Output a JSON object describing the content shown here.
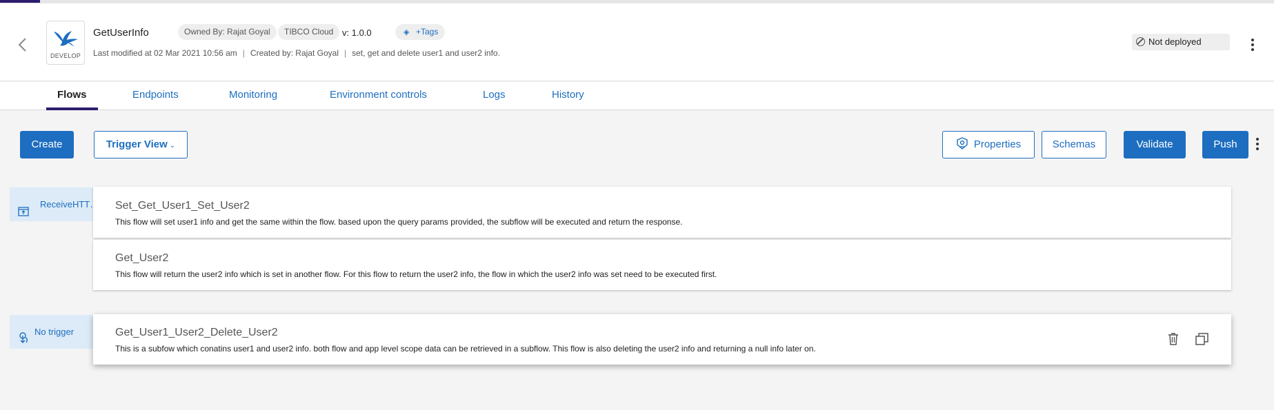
{
  "app": {
    "name": "GetUserInfo",
    "stage_badge": "DEVELOP",
    "owned_by": "Owned By: Rajat Goyal",
    "cloud": "TIBCO Cloud",
    "version": "v: 1.0.0",
    "tags_label": "+Tags",
    "last_modified": "Last modified at 02 Mar 2021 10:56 am",
    "created_by": "Created by: Rajat Goyal",
    "description": "set, get and delete user1 and user2 info.",
    "deploy_status": "Not deployed"
  },
  "tabs": [
    {
      "label": "Flows",
      "active": true
    },
    {
      "label": "Endpoints",
      "active": false
    },
    {
      "label": "Monitoring",
      "active": false
    },
    {
      "label": "Environment controls",
      "active": false
    },
    {
      "label": "Logs",
      "active": false
    },
    {
      "label": "History",
      "active": false
    }
  ],
  "toolbar": {
    "create": "Create",
    "trigger_view": "Trigger View",
    "properties": "Properties",
    "schemas": "Schemas",
    "validate": "Validate",
    "push": "Push"
  },
  "triggers": [
    {
      "label": "ReceiveHTTPMessage",
      "icon": "receive-http-icon"
    },
    {
      "label": "No trigger",
      "icon": "no-trigger-icon"
    }
  ],
  "flows": [
    {
      "name": "Set_Get_User1_Set_User2",
      "description": "This flow will set user1 info and get the same within the flow. based upon the query params provided, the subflow will be executed and return the response."
    },
    {
      "name": "Get_User2",
      "description": "This flow will return the user2 info which is set in another flow. For this flow to return the user2 info, the flow in which the user2 info was set need to be executed first."
    },
    {
      "name": "Get_User1_User2_Delete_User2",
      "description": "This is a subfow which conatins user1 and user2 info. both flow and app level scope data can be retrieved in a subflow. This flow is also deleting the user2 info and returning a null info later on."
    }
  ],
  "colors": {
    "accent": "#1d6ec0",
    "tab_indicator": "#2d1d6e",
    "trigger_bg": "#dcebf7"
  }
}
